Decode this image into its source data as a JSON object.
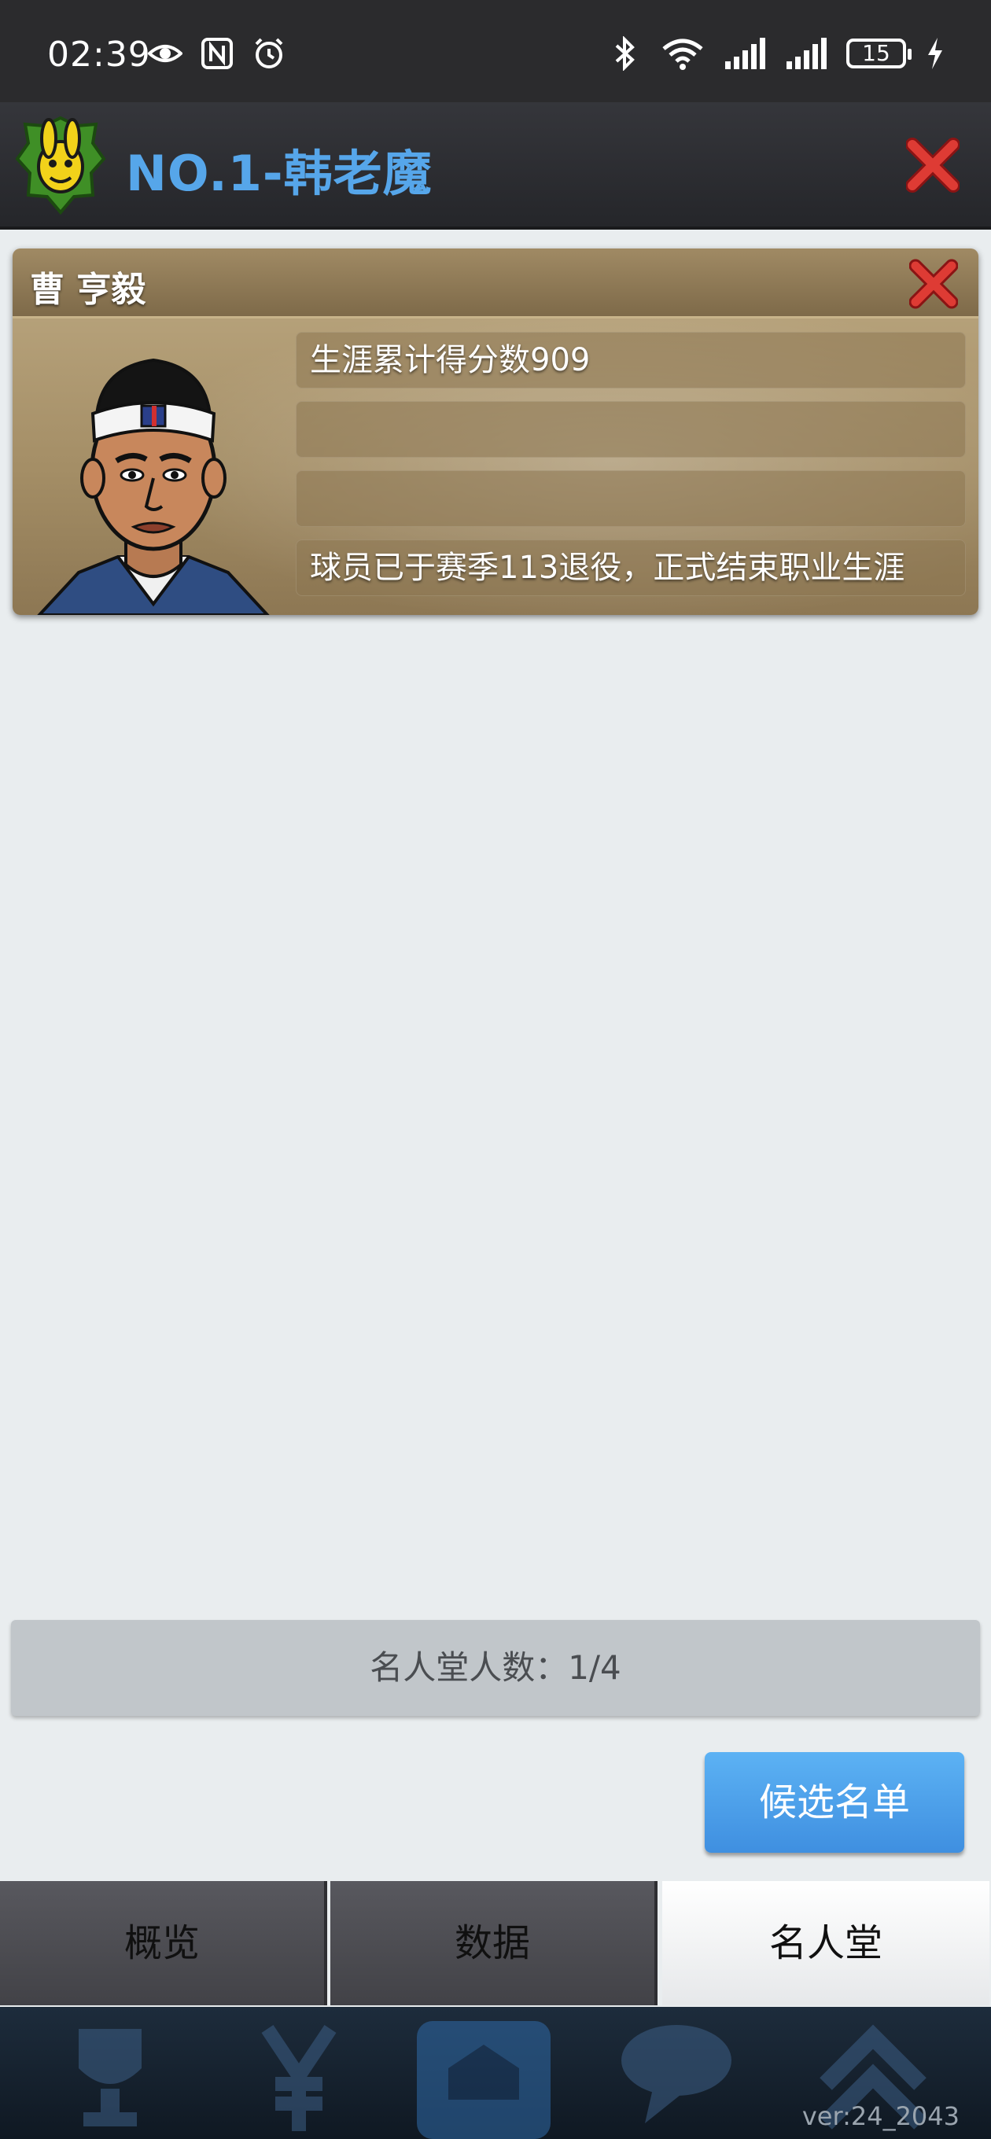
{
  "status_bar": {
    "time": "02:39",
    "battery_level": "15",
    "icons_left": [
      "eye-icon",
      "nfc-icon",
      "alarm-icon"
    ],
    "icons_right": [
      "bluetooth-icon",
      "wifi-icon",
      "signal-icon",
      "signal-icon",
      "battery-icon",
      "charging-icon"
    ]
  },
  "header": {
    "title": "NO.1-韩老魔",
    "title_color": "#56a6ea"
  },
  "player_card": {
    "name": "曹 亨毅",
    "stats": [
      "生涯累计得分数909",
      "",
      "",
      "球员已于赛季113退役，正式结束职业生涯"
    ]
  },
  "hall_of_fame": {
    "count_text": "名人堂人数：1/4"
  },
  "candidate_button": {
    "label": "候选名单"
  },
  "tabs": [
    {
      "label": "概览",
      "active": false
    },
    {
      "label": "数据",
      "active": false
    },
    {
      "label": "名人堂",
      "active": true
    }
  ],
  "footer": {
    "version": "ver:24_2043"
  },
  "colors": {
    "accent_blue": "#4a9ae8",
    "close_red": "#d32f2f",
    "card_gold": "#a48e66"
  }
}
